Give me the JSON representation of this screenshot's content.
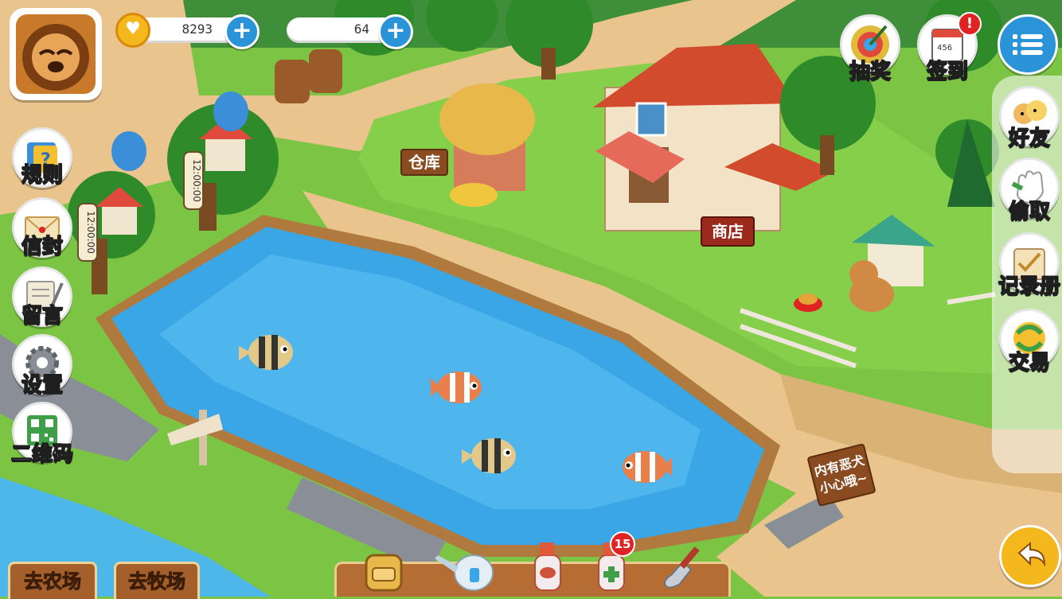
{
  "resources": {
    "coins": "8293",
    "gems": "64"
  },
  "top_right": {
    "lottery_label": "抽奖",
    "checkin_label": "签到",
    "checkin_badge": "!"
  },
  "left_menu": {
    "rules": "规则",
    "mail": "信封",
    "message": "留言",
    "settings": "设置",
    "qrcode": "二维码"
  },
  "right_menu": {
    "friends": "好友",
    "steal": "偷取",
    "records": "记录册",
    "trade": "交易"
  },
  "scene": {
    "warehouse_sign": "仓库",
    "shop_sign": "商店",
    "dog_warning": "内有恶犬 小心哦~",
    "timer_left": "12:00:00",
    "timer_right": "12:00:00"
  },
  "bottom": {
    "go_farm": "去农场",
    "go_ranch": "去牧场",
    "tool_badge": "15"
  },
  "colors": {
    "grass": "#7cc444",
    "water": "#3aa6e6",
    "path": "#e8c48a",
    "plus_blue": "#2b93d8",
    "sign_wood": "#8a4b21",
    "badge_red": "#e02222"
  }
}
